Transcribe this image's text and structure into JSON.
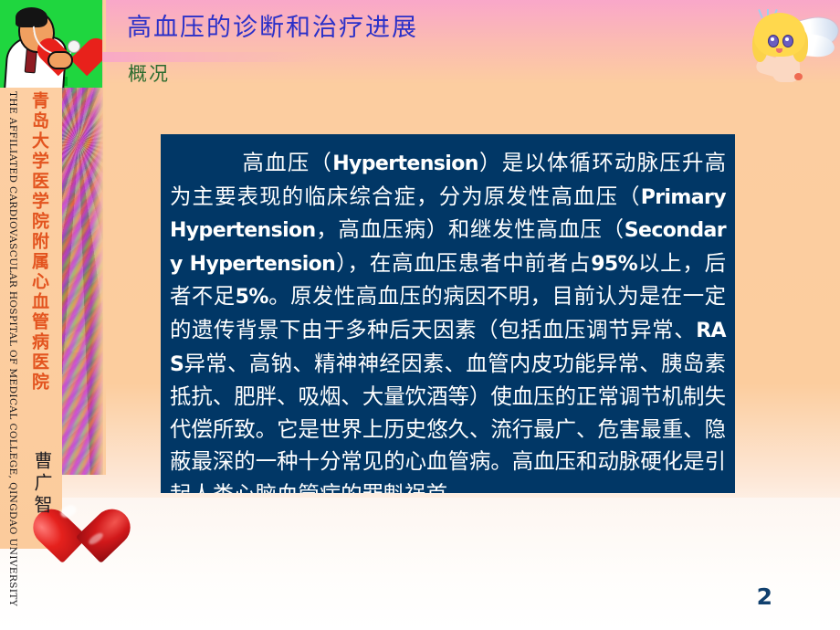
{
  "slide": {
    "title": "高血压的诊断和治疗进展",
    "subtitle": "概况",
    "page_number": "2",
    "title_color": "#2b30c8",
    "subtitle_color": "#2b6b2e",
    "content_box_color": "#013766",
    "background_top_color": "#f9a7c9",
    "background_body_color": "#fccd9e",
    "page_number_color": "#11406e"
  },
  "sidebar": {
    "organization_cn": "青岛大学医学院附属心血管病医院",
    "organization_en": "THE AFFILIATED CARDIOVASCULAR HOSPITAL OF MEDICAL COLLEGE, QINGDAO UNIVERSITY",
    "author_cn": "曹广智",
    "organization_cn_color": "#e3541f"
  },
  "content": {
    "segments": [
      {
        "text": "高血压（",
        "bold": false
      },
      {
        "text": "Hypertension",
        "bold": true
      },
      {
        "text": "）是以体循环动脉压升高为主要表现的临床综合症，分为原发性高血压（",
        "bold": false
      },
      {
        "text": "Primary Hypertension",
        "bold": true
      },
      {
        "text": "，高血压病）和继发性高血压（",
        "bold": false
      },
      {
        "text": "Secondary Hypertension",
        "bold": true
      },
      {
        "text": "），在高血压患者中前者占",
        "bold": false
      },
      {
        "text": "95%",
        "bold": true
      },
      {
        "text": "以上，后者不足",
        "bold": false
      },
      {
        "text": "5%",
        "bold": true
      },
      {
        "text": "。原发性高血压的病因不明，目前认为是在一定的遗传背景下由于多种后天因素（包括血压调节异常、",
        "bold": false
      },
      {
        "text": "RAS",
        "bold": true
      },
      {
        "text": "异常、高钠、精神神经因素、血管内皮功能异常、胰岛素抵抗、肥胖、吸烟、大量饮酒等）使血压的正常调节机制失代偿所致。它是世界上历史悠久、流行最广、危害最重、隐蔽最深的一种十分常见的心血管病。高血压和动脉硬化是引起人类心脑血管病的罪魁祸首。",
        "bold": false
      }
    ]
  },
  "decorations": {
    "doctor_image_alt": "doctor-examining-heart-clipart",
    "cherub_image_alt": "winged-cherub-clipart",
    "heart_image_alt": "glossy-red-heart-graphic",
    "texture_strip_alt": "multicolor-texture-strip"
  }
}
